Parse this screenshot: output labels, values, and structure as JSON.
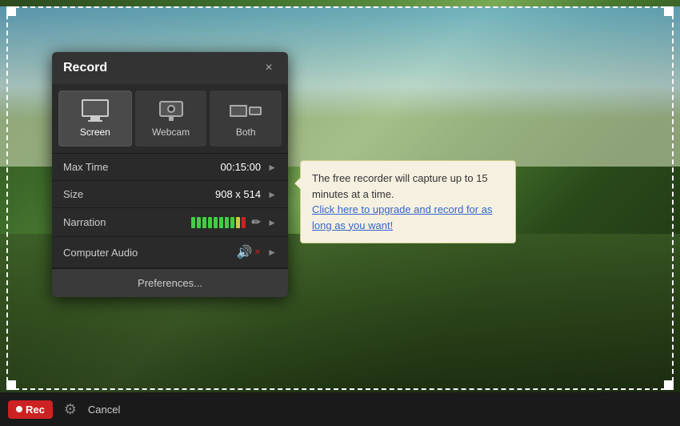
{
  "dialog": {
    "title": "Record",
    "close_label": "×"
  },
  "modes": [
    {
      "id": "screen",
      "label": "Screen",
      "active": true
    },
    {
      "id": "webcam",
      "label": "Webcam",
      "active": false
    },
    {
      "id": "both",
      "label": "Both",
      "active": false
    }
  ],
  "settings": [
    {
      "label": "Max Time",
      "value": "00:15:00"
    },
    {
      "label": "Size",
      "value": "908 x 514"
    },
    {
      "label": "Narration",
      "value": ""
    },
    {
      "label": "Computer Audio",
      "value": ""
    }
  ],
  "preferences_label": "Preferences...",
  "tooltip": {
    "text": "The free recorder will capture up to 15 minutes at a time.",
    "link_text": "Click here to upgrade and record for as long as you want!"
  },
  "toolbar": {
    "rec_label": "Rec",
    "cancel_label": "Cancel"
  }
}
